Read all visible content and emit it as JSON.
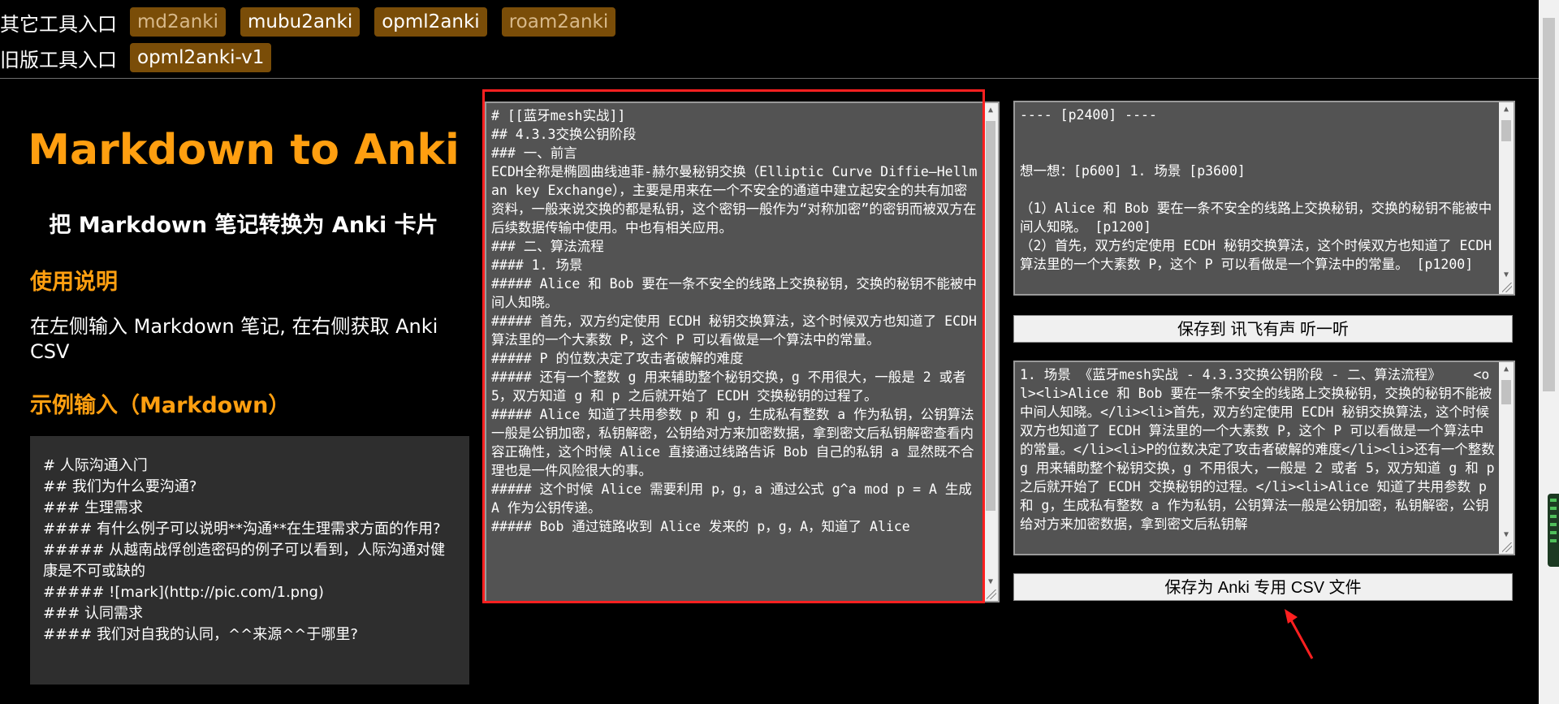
{
  "tools": {
    "other_label": "其它工具入口",
    "other_links": [
      {
        "label": "md2anki",
        "dim": true
      },
      {
        "label": "mubu2anki",
        "dim": false
      },
      {
        "label": "opml2anki",
        "dim": false
      },
      {
        "label": "roam2anki",
        "dim": true
      }
    ],
    "old_label": "旧版工具入口",
    "old_links": [
      {
        "label": "opml2anki-v1"
      }
    ]
  },
  "left": {
    "title": "Markdown to Anki",
    "subtitle": "把 Markdown 笔记转换为 Anki 卡片",
    "usage_heading": "使用说明",
    "usage_text": "在左侧输入 Markdown 笔记, 在右侧获取 Anki CSV",
    "example_heading": "示例输入（Markdown）",
    "example_lines": [
      "# 人际沟通入门",
      "## 我们为什么要沟通?",
      "### 生理需求",
      "#### 有什么例子可以说明**沟通**在生理需求方面的作用?",
      "##### 从越南战俘创造密码的例子可以看到，人际沟通对健康是不可或缺的",
      "##### ![mark](http://pic.com/1.png)",
      "### 认同需求",
      "#### 我们对自我的认同，^^来源^^于哪里?"
    ]
  },
  "markdown_input": {
    "text": "# [[蓝牙mesh实战]]\n## 4.3.3交换公钥阶段\n### 一、前言\nECDH全称是椭圆曲线迪菲-赫尔曼秘钥交换（Elliptic Curve Diffie–Hellman key Exchange），主要是用来在一个不安全的通道中建立起安全的共有加密资料，一般来说交换的都是私钥，这个密钥一般作为“对称加密”的密钥而被双方在后续数据传输中使用。中也有相关应用。\n### 二、算法流程\n#### 1. 场景\n##### Alice 和 Bob 要在一条不安全的线路上交换秘钥，交换的秘钥不能被中间人知晓。\n##### 首先，双方约定使用 ECDH 秘钥交换算法，这个时候双方也知道了 ECDH 算法里的一个大素数 P，这个 P 可以看做是一个算法中的常量。\n##### P 的位数决定了攻击者破解的难度\n##### 还有一个整数 g 用来辅助整个秘钥交换，g 不用很大，一般是 2 或者 5，双方知道 g 和 p 之后就开始了 ECDH 交换秘钥的过程了。\n##### Alice 知道了共用参数 p 和 g，生成私有整数 a 作为私钥，公钥算法一般是公钥加密，私钥解密，公钥给对方来加密数据，拿到密文后私钥解密查看内容正确性，这个时候 Alice 直接通过线路告诉 Bob 自己的私钥 a 显然既不合理也是一件风险很大的事。\n##### 这个时候 Alice 需要利用 p，g，a 通过公式 g^a mod p = A 生成 A 作为公钥传递。\n##### Bob 通过链路收到 Alice 发来的 p，g，A，知道了 Alice"
  },
  "preview": {
    "text": "---- [p2400] ----\n\n\n想一想：[p600] 1. 场景 [p3600]\n\n（1）Alice 和 Bob 要在一条不安全的线路上交换秘钥，交换的秘钥不能被中间人知晓。 [p1200]\n（2）首先，双方约定使用 ECDH 秘钥交换算法，这个时候双方也知道了 ECDH 算法里的一个大素数 P，这个 P 可以看做是一个算法中的常量。 [p1200]"
  },
  "buttons": {
    "xunfei": "保存到 讯飞有声 听一听",
    "csv": "保存为 Anki 专用 CSV 文件"
  },
  "csv_output": {
    "text": "1. 场景 《蓝牙mesh实战 - 4.3.3交换公钥阶段 - 二、算法流程》    <ol><li>Alice 和 Bob 要在一条不安全的线路上交换秘钥，交换的秘钥不能被中间人知晓。</li><li>首先，双方约定使用 ECDH 秘钥交换算法，这个时候双方也知道了 ECDH 算法里的一个大素数 P，这个 P 可以看做是一个算法中的常量。</li><li>P的位数决定了攻击者破解的难度</li><li>还有一个整数 g 用来辅助整个秘钥交换，g 不用很大，一般是 2 或者 5，双方知道 g 和 p 之后就开始了 ECDH 交换秘钥的过程。</li><li>Alice 知道了共用参数 p 和 g，生成私有整数 a 作为私钥，公钥算法一般是公钥加密，私钥解密，公钥给对方来加密数据，拿到密文后私钥解"
  },
  "colors": {
    "accent": "#ff9f10",
    "tag_bg": "#7a4d08",
    "panel_bg": "#535353",
    "highlight": "#ff2020"
  }
}
